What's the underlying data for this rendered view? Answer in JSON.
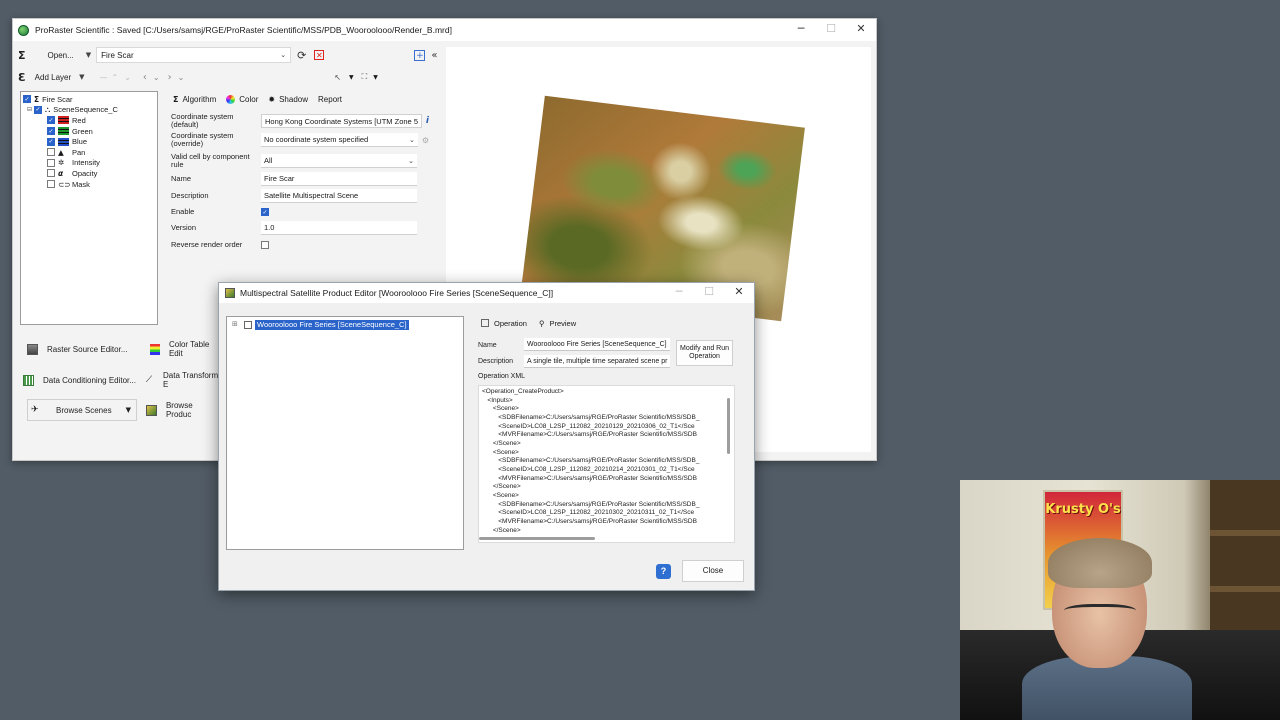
{
  "main_window": {
    "title": "ProRaster Scientific : Saved [C:/Users/samsj/RGE/ProRaster Scientific/MSS/PDB_Wooroolooo/Render_B.mrd]",
    "open_label": "Open...",
    "layer_combo": "Fire Scar",
    "add_layer_label": "Add Layer",
    "layer_tree": [
      {
        "label": "Fire Scar",
        "checked": true,
        "indent": 0,
        "icon": "sigma-icon"
      },
      {
        "label": "SceneSequence_C",
        "checked": true,
        "indent": 1,
        "icon": "scene-sequence-icon"
      },
      {
        "label": "Red",
        "checked": true,
        "indent": 2,
        "icon": "red-band-icon",
        "color": "#d02020"
      },
      {
        "label": "Green",
        "checked": true,
        "indent": 2,
        "icon": "green-band-icon",
        "color": "#1f9a2e"
      },
      {
        "label": "Blue",
        "checked": true,
        "indent": 2,
        "icon": "blue-band-icon",
        "color": "#2550c8"
      },
      {
        "label": "Pan",
        "checked": false,
        "indent": 2,
        "icon": "pan-icon"
      },
      {
        "label": "Intensity",
        "checked": false,
        "indent": 2,
        "icon": "intensity-icon"
      },
      {
        "label": "Opacity",
        "checked": false,
        "indent": 2,
        "icon": "opacity-icon"
      },
      {
        "label": "Mask",
        "checked": false,
        "indent": 2,
        "icon": "mask-icon"
      }
    ],
    "tabs": [
      "Algorithm",
      "Color",
      "Shadow",
      "Report"
    ],
    "properties": {
      "coord_default_label": "Coordinate system (default)",
      "coord_default_value": "Hong Kong Coordinate Systems [UTM Zone 5",
      "coord_override_label": "Coordinate system (override)",
      "coord_override_value": "No coordinate system specified",
      "valid_cell_label": "Valid cell by component rule",
      "valid_cell_value": "All",
      "name_label": "Name",
      "name_value": "Fire Scar",
      "description_label": "Description",
      "description_value": "Satellite Multispectral Scene",
      "enable_label": "Enable",
      "enable_checked": true,
      "version_label": "Version",
      "version_value": "1.0",
      "reverse_label": "Reverse render order",
      "reverse_checked": false
    },
    "left_buttons": {
      "raster_source": "Raster Source Editor...",
      "color_table": "Color Table Edit",
      "data_conditioning": "Data Conditioning Editor...",
      "data_transform": "Data Transform E",
      "browse_scenes": "Browse Scenes",
      "browse_products": "Browse Produc"
    }
  },
  "dialog": {
    "title": "Multispectral Satellite Product Editor [Wooroolooo Fire Series [SceneSequence_C]]",
    "tree_selected": "Wooroolooo Fire Series [SceneSequence_C]",
    "tabs": [
      "Operation",
      "Preview"
    ],
    "name_label": "Name",
    "name_value": "Wooroolooo Fire Series [SceneSequence_C]",
    "description_label": "Description",
    "description_value": "A single tile, multiple time separated scene pr",
    "run_button": "Modify and Run Operation",
    "xml_label": "Operation XML",
    "xml_lines": [
      "<Operation_CreateProduct>",
      "   <Inputs>",
      "      <Scene>",
      "         <SDBFilename>C:/Users/samsj/RGE/ProRaster Scientific/MSS/SDB_",
      "         <SceneID>LC08_L2SP_112082_20210129_20210306_02_T1</Sce",
      "         <MVRFilename>C:/Users/samsj/RGE/ProRaster Scientific/MSS/SDB",
      "      </Scene>",
      "      <Scene>",
      "         <SDBFilename>C:/Users/samsj/RGE/ProRaster Scientific/MSS/SDB_",
      "         <SceneID>LC08_L2SP_112082_20210214_20210301_02_T1</Sce",
      "         <MVRFilename>C:/Users/samsj/RGE/ProRaster Scientific/MSS/SDB",
      "      </Scene>",
      "      <Scene>",
      "         <SDBFilename>C:/Users/samsj/RGE/ProRaster Scientific/MSS/SDB_",
      "         <SceneID>LC08_L2SP_112082_20210302_20210311_02_T1</Sce",
      "         <MVRFilename>C:/Users/samsj/RGE/ProRaster Scientific/MSS/SDB",
      "      </Scene>"
    ],
    "help_label": "?",
    "close_button": "Close"
  },
  "webcam": {
    "poster_text": "Krusty O's"
  }
}
